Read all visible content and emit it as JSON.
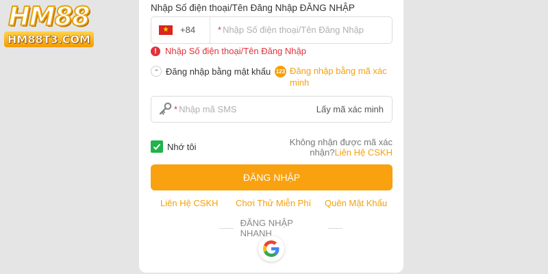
{
  "logo": {
    "big": "HM88",
    "small": "HM88T3.COM"
  },
  "form": {
    "title": "Nhập Số điện thoại/Tên Đăng Nhập ĐĂNG NHẬP",
    "phone": {
      "country_code": "+84",
      "placeholder_star": "*",
      "placeholder": "Nhập Số điện thoại/Tên Đăng Nhập"
    },
    "error": {
      "icon": "!",
      "text": "Nhập Số điện thoại/Tên Đăng Nhập"
    },
    "login_options": {
      "password_icon": "**",
      "password": "Đăng nhập bằng mật khẩu",
      "code_icon": "123",
      "code": "Đăng nhập bằng mã xác minh"
    },
    "sms": {
      "placeholder_star": "*",
      "placeholder": "Nhập mã SMS",
      "get_code": "Lấy mã xác minh"
    },
    "remember": "Nhớ tôi",
    "no_code": {
      "text": "Không nhận được mã xác nhận?",
      "link": "Liên Hệ CSKH"
    },
    "login_button": "ĐĂNG NHẬP",
    "footer_links": {
      "support": "Liên Hệ CSKH",
      "trial": "Chơi Thử Miễn Phí",
      "forgot": "Quên Mật Khẩu"
    },
    "quick_login": "ĐĂNG NHẬP NHANH"
  },
  "colors": {
    "accent": "#f9a10f",
    "error": "#e0323a",
    "checkbox": "#1fb34a",
    "background": "#e5e5e5"
  },
  "icons": [
    "vietnam-flag-icon",
    "exclamation-icon",
    "asterisks-icon",
    "numbers-123-icon",
    "key-icon",
    "checkmark-icon",
    "google-icon"
  ]
}
